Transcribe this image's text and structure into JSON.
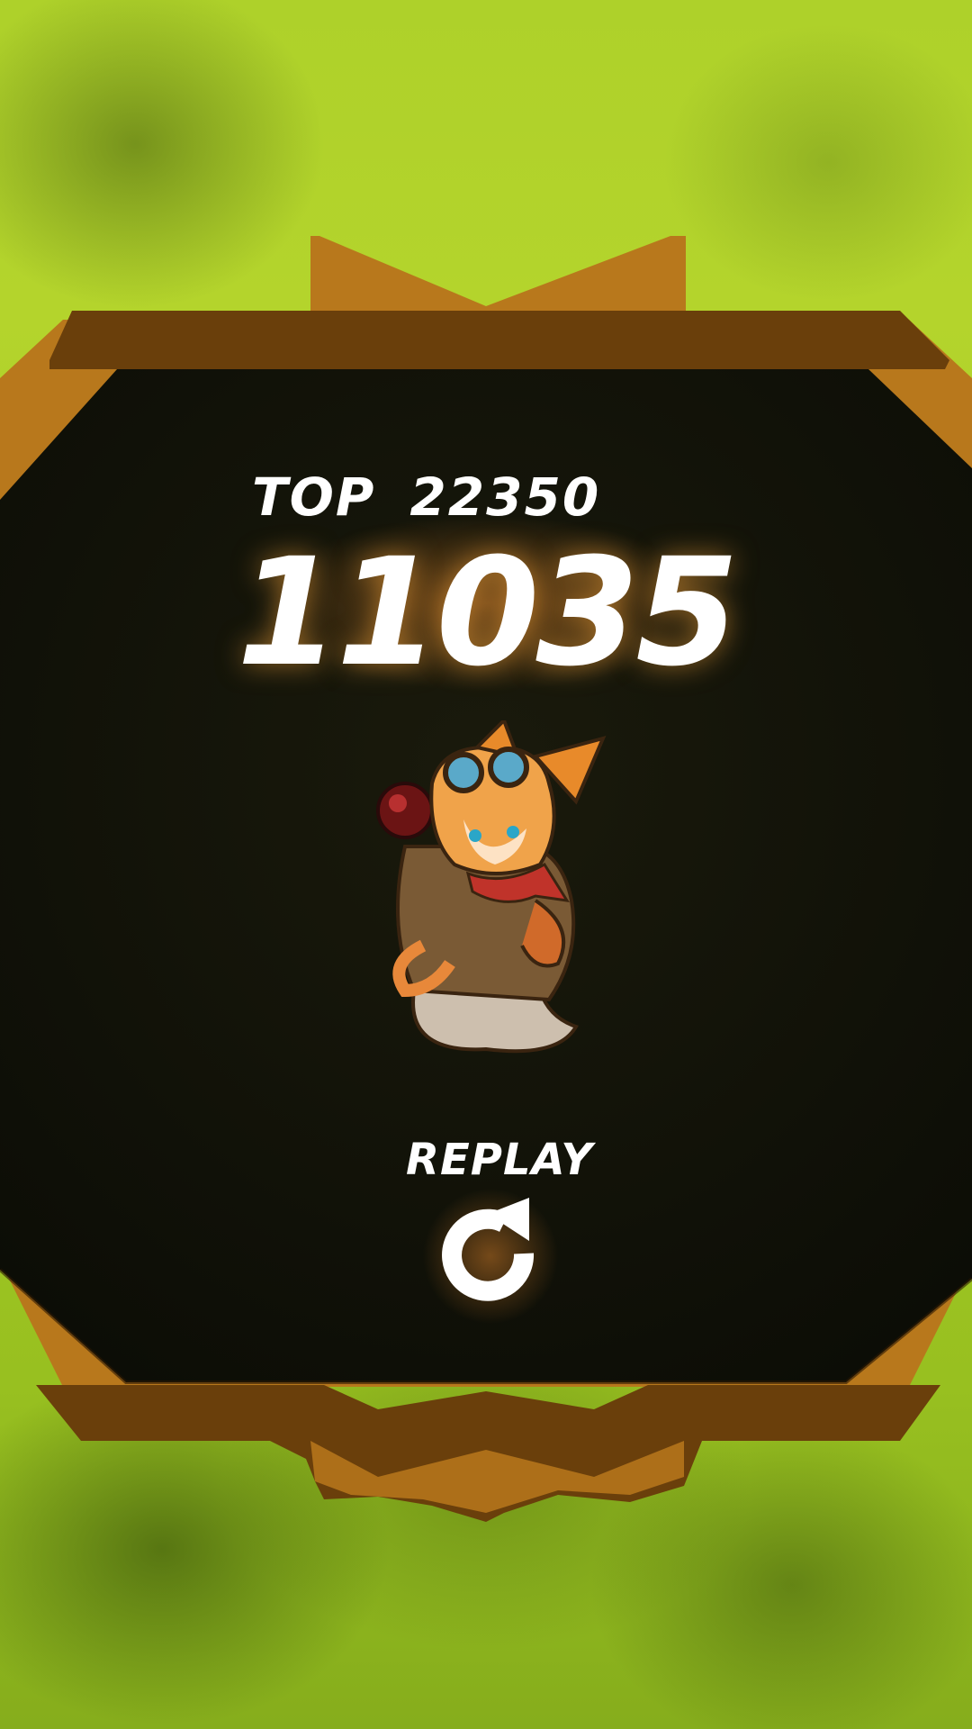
{
  "screen": "game-over",
  "best_score": {
    "label": "TOP",
    "value": "22350"
  },
  "current_score": "11035",
  "character": {
    "icon": "fox-adventurer-with-goggles"
  },
  "replay": {
    "label": "REPLAY",
    "icon": "replay-arrow-icon"
  },
  "colors": {
    "grass": "#a3c825",
    "frame_wood": "#b87a1e",
    "frame_dark": "#6b3f0c",
    "panel": "#111107",
    "text": "#ffffff",
    "glow": "#c8782a"
  }
}
